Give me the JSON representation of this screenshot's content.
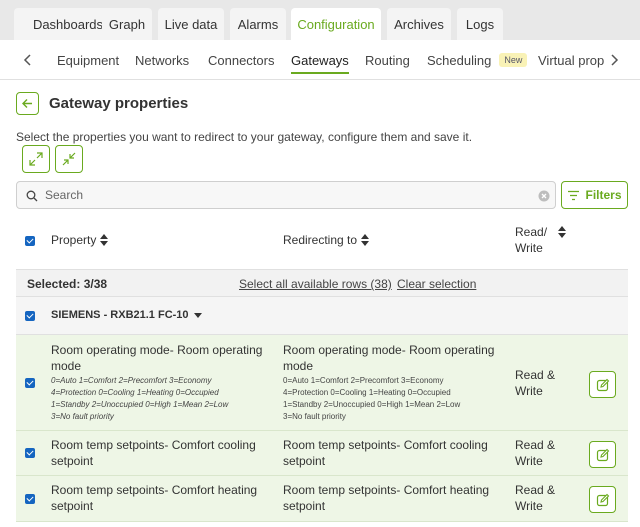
{
  "top_tabs": [
    "Dashboards",
    "Graph",
    "Live data",
    "Alarms",
    "Configuration",
    "Archives",
    "Logs"
  ],
  "top_tab_active": "Configuration",
  "sub_tabs": [
    "Equipment",
    "Networks",
    "Connectors",
    "Gateways",
    "Routing",
    "Scheduling",
    "Virtual prop"
  ],
  "sub_tab_active": "Gateways",
  "scheduling_badge": "New",
  "page_title": "Gateway properties",
  "instructions": "Select the properties you want to redirect to your gateway, configure them and save it.",
  "search": {
    "placeholder": "Search"
  },
  "filters_label": "Filters",
  "table": {
    "col_property": "Property",
    "col_redirecting": "Redirecting to",
    "col_rw_1": "Read/",
    "col_rw_2": "Write"
  },
  "selection": {
    "count": "Selected: 3/38",
    "select_all": "Select all available rows (38)",
    "clear": "Clear selection"
  },
  "group": {
    "label": "SIEMENS - RXB21.1 FC-10"
  },
  "rows": [
    {
      "prop_title_1": "Room operating mode- Room operating",
      "prop_title_2": "mode",
      "desc_1": "0=Auto 1=Comfort 2=Precomfort 3=Economy",
      "desc_2": "4=Protection 0=Cooling 1=Heating 0=Occupied",
      "desc_3": "1=Standby 2=Unoccupied 0=High 1=Mean 2=Low",
      "desc_4": "3=No fault priority",
      "redir_title_1": "Room operating mode- Room operating",
      "redir_title_2": "mode",
      "rdesc_1": "0=Auto 1=Comfort 2=Precomfort 3=Economy",
      "rdesc_2": "4=Protection 0=Cooling 1=Heating 0=Occupied",
      "rdesc_3": "1=Standby 2=Unoccupied 0=High 1=Mean 2=Low",
      "rdesc_4": "3=No fault priority",
      "rw_1": "Read &",
      "rw_2": "Write"
    },
    {
      "prop_title_1": "Room temp setpoints- Comfort cooling",
      "prop_title_2": "setpoint",
      "redir_title_1": "Room temp setpoints- Comfort cooling",
      "redir_title_2": "setpoint",
      "rw_1": "Read &",
      "rw_2": "Write"
    },
    {
      "prop_title_1": "Room temp setpoints- Comfort heating",
      "prop_title_2": "setpoint",
      "redir_title_1": "Room temp setpoints- Comfort heating",
      "redir_title_2": "setpoint",
      "rw_1": "Read &",
      "rw_2": "Write"
    }
  ],
  "colors": {
    "accent": "#6aaa1f",
    "checkbox": "#1565c0",
    "row_selected_bg": "#eef6e6"
  },
  "icons": [
    "arrow-left-icon",
    "expand-icon",
    "collapse-icon",
    "search-icon",
    "clear-icon",
    "filter-icon",
    "chevron-left-icon",
    "chevron-right-icon",
    "sort-icon",
    "caret-down-icon",
    "edit-icon",
    "checkbox-checked-icon"
  ]
}
